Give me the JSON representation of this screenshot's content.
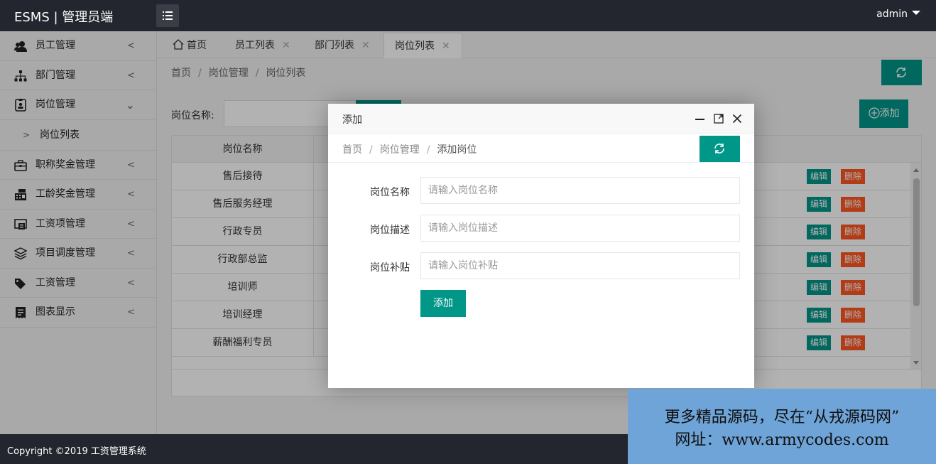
{
  "header": {
    "brand": "ESMS | 管理员端",
    "user": "admin"
  },
  "sidebar": {
    "items": [
      {
        "label": "员工管理",
        "icon": "users-icon"
      },
      {
        "label": "部门管理",
        "icon": "sitemap-icon"
      },
      {
        "label": "岗位管理",
        "icon": "badge-icon",
        "expanded": true
      },
      {
        "label": "职称奖金管理",
        "icon": "briefcase-icon"
      },
      {
        "label": "工龄奖金管理",
        "icon": "cash-register-icon"
      },
      {
        "label": "工资项管理",
        "icon": "list-alt-icon"
      },
      {
        "label": "项目调度管理",
        "icon": "layers-icon"
      },
      {
        "label": "工资管理",
        "icon": "tags-icon"
      },
      {
        "label": "图表显示",
        "icon": "receipt-icon"
      }
    ],
    "sub_items": [
      {
        "label": "岗位列表"
      }
    ]
  },
  "tabs": [
    {
      "label": "首页",
      "icon": "home-icon"
    },
    {
      "label": "员工列表"
    },
    {
      "label": "部门列表"
    },
    {
      "label": "岗位列表",
      "active": true
    }
  ],
  "main": {
    "breadcrumb": [
      "首页",
      "岗位管理",
      "岗位列表"
    ],
    "search_label": "岗位名称:",
    "add_button": "添加",
    "table": {
      "header": "岗位名称",
      "rows": [
        "售后接待",
        "售后服务经理",
        "行政专员",
        "行政部总监",
        "培训师",
        "培训经理",
        "薪酬福利专员"
      ],
      "edit_label": "编辑",
      "delete_label": "删除"
    }
  },
  "modal": {
    "title": "添加",
    "breadcrumb": [
      "首页",
      "岗位管理",
      "添加岗位"
    ],
    "fields": [
      {
        "label": "岗位名称",
        "placeholder": "请输入岗位名称"
      },
      {
        "label": "岗位描述",
        "placeholder": "请输入岗位描述"
      },
      {
        "label": "岗位补贴",
        "placeholder": "请输入岗位补贴"
      }
    ],
    "submit": "添加"
  },
  "footer": {
    "copyright": "Copyright ©2019 工资管理系统"
  },
  "watermark": {
    "line1": "更多精品源码，尽在“从戎源码网”",
    "line2": "网址：www.armycodes.com"
  },
  "colors": {
    "header_bg": "#23262e",
    "accent": "#009688",
    "danger": "#ff5722",
    "sidebar_bg": "#f2f2f2",
    "watermark_bg": "#6fa4d8"
  }
}
